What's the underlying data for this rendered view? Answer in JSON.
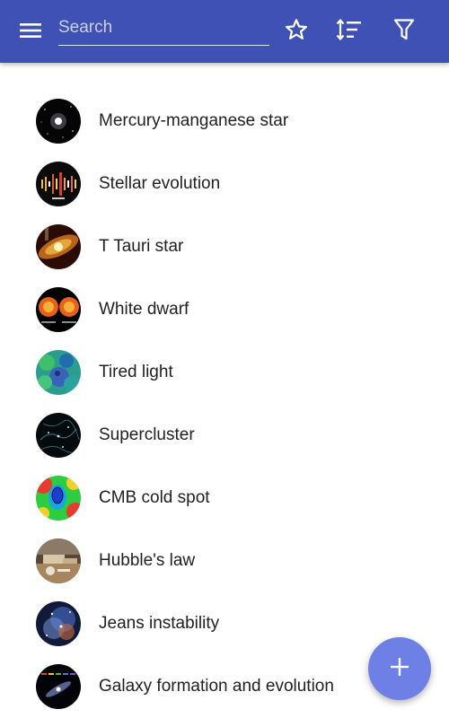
{
  "app": {
    "colors": {
      "appbar": "#3f51b5",
      "fab": "#6e7fe6",
      "text": "#212121",
      "icon": "#ffffff"
    }
  },
  "toolbar": {
    "menu_icon": "menu-icon",
    "search": {
      "placeholder": "Search",
      "value": ""
    },
    "actions": [
      {
        "icon": "star-outline-icon"
      },
      {
        "icon": "sort-icon"
      },
      {
        "icon": "filter-icon"
      }
    ]
  },
  "list": {
    "items": [
      {
        "label": "Mercury-manganese star"
      },
      {
        "label": "Stellar evolution"
      },
      {
        "label": "T Tauri star"
      },
      {
        "label": "White dwarf"
      },
      {
        "label": "Tired light"
      },
      {
        "label": "Supercluster"
      },
      {
        "label": "CMB cold spot"
      },
      {
        "label": "Hubble's law"
      },
      {
        "label": "Jeans instability"
      },
      {
        "label": "Galaxy formation and evolution"
      }
    ]
  },
  "fab": {
    "icon": "plus-icon"
  }
}
